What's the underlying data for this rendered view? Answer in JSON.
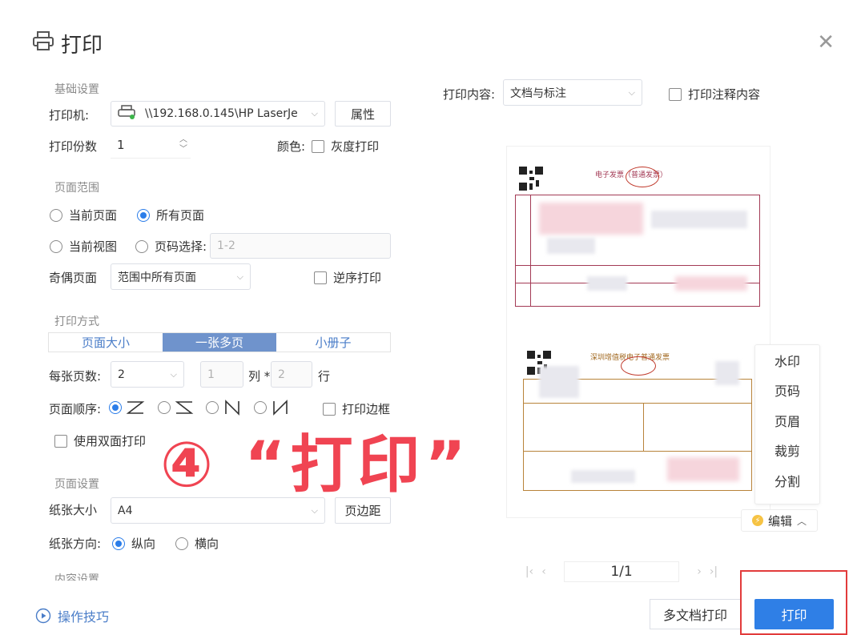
{
  "dialog": {
    "title": "打印",
    "close_symbol": "✕"
  },
  "basic": {
    "section": "基础设置",
    "printer_label": "打印机:",
    "printer_value": "\\\\192.168.0.145\\HP LaserJe",
    "properties_btn": "属性",
    "copies_label": "打印份数",
    "copies_value": "1",
    "color_label": "颜色:",
    "grayscale_label": "灰度打印"
  },
  "range": {
    "section": "页面范围",
    "current_page": "当前页面",
    "all_pages": "所有页面",
    "current_view": "当前视图",
    "page_select": "页码选择:",
    "page_select_placeholder": "1-2",
    "odd_even_label": "奇偶页面",
    "odd_even_value": "范围中所有页面",
    "reverse_label": "逆序打印"
  },
  "mode": {
    "section": "打印方式",
    "tabs": [
      "页面大小",
      "一张多页",
      "小册子"
    ],
    "active_tab": 1,
    "per_sheet_label": "每张页数:",
    "per_sheet_value": "2",
    "cols_value": "1",
    "cols_label": "列 *",
    "rows_value": "2",
    "rows_label": "行",
    "order_label": "页面顺序:",
    "border_label": "打印边框",
    "duplex_label": "使用双面打印"
  },
  "page_setup": {
    "section": "页面设置",
    "paper_label": "纸张大小",
    "paper_value": "A4",
    "margin_btn": "页边距",
    "orientation_label": "纸张方向:",
    "portrait": "纵向",
    "landscape": "横向",
    "content_section": "内容设置"
  },
  "right": {
    "content_label": "打印内容:",
    "content_value": "文档与标注",
    "annot_label": "打印注释内容",
    "invoice1_title": "电子发票（普通发票）",
    "invoice2_title": "深圳增值税电子普通发票",
    "side_menu": [
      "水印",
      "页码",
      "页眉",
      "裁剪",
      "分割"
    ],
    "edit_label": "编辑",
    "page_indicator": "1/1"
  },
  "overlay_text": "④ “打印”",
  "footer": {
    "tips": "操作技巧",
    "multi_print": "多文档打印",
    "print": "打印"
  },
  "colors": {
    "accent": "#2f7fe6",
    "annotation_red": "#f04452",
    "invoice_line": "#a33a55"
  }
}
